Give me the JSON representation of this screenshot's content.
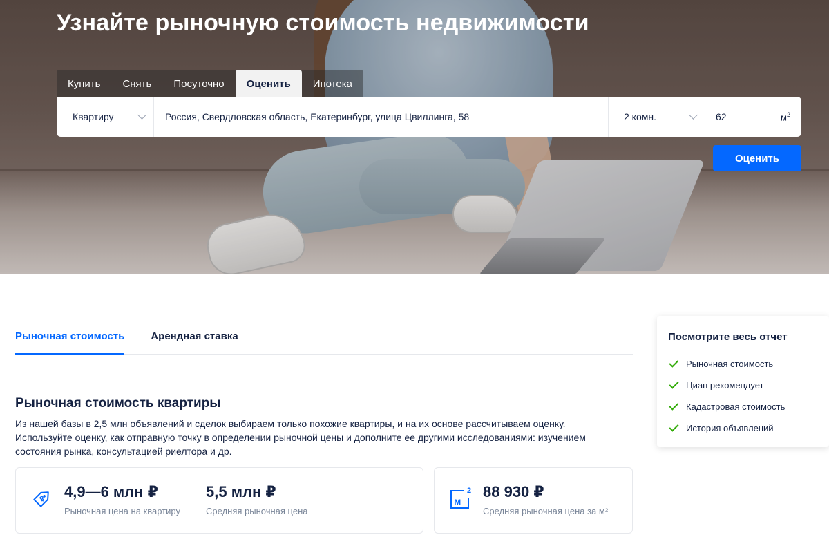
{
  "hero": {
    "title": "Узнайте рыночную стоимость недвижимости",
    "tabs": [
      {
        "label": "Купить",
        "active": false
      },
      {
        "label": "Снять",
        "active": false
      },
      {
        "label": "Посуточно",
        "active": false
      },
      {
        "label": "Оценить",
        "active": true
      },
      {
        "label": "Ипотека",
        "active": false
      }
    ]
  },
  "search": {
    "property_type": "Квартиру",
    "address": "Россия, Свердловская область, Екатеринбург, улица Цвиллинга, 58",
    "rooms": "2 комн.",
    "area": "62",
    "area_unit": "м",
    "area_unit_sup": "2",
    "submit_label": "Оценить"
  },
  "content": {
    "tabs": [
      {
        "label": "Рыночная стоимость",
        "active": true
      },
      {
        "label": "Арендная ставка",
        "active": false
      }
    ],
    "section_title": "Рыночная стоимость квартиры",
    "section_desc": "Из нашей базы в 2,5 млн объявлений и сделок выбираем только похожие квартиры, и на их основе рассчитываем оценку. Используйте оценку, как отправную точку в определении рыночной цены и дополните ее другими исследованиями: изучением состояния рынка, консультацией риелтора и др.",
    "card_price": {
      "range_value": "4,9—6 млн ₽",
      "range_label": "Рыночная цена на квартиру",
      "avg_value": "5,5 млн ₽",
      "avg_label": "Средняя рыночная цена"
    },
    "card_m2": {
      "icon_text": "м",
      "icon_sup": "2",
      "value": "88 930 ₽",
      "label": "Средняя рыночная цена за м²"
    }
  },
  "report": {
    "title": "Посмотрите весь отчет",
    "items": [
      "Рыночная стоимость",
      "Циан рекомендует",
      "Кадастровая стоимость",
      "История объявлений"
    ]
  },
  "colors": {
    "accent": "#0468ff",
    "text": "#152242",
    "muted": "#7a8699",
    "check": "#34ac0a"
  }
}
